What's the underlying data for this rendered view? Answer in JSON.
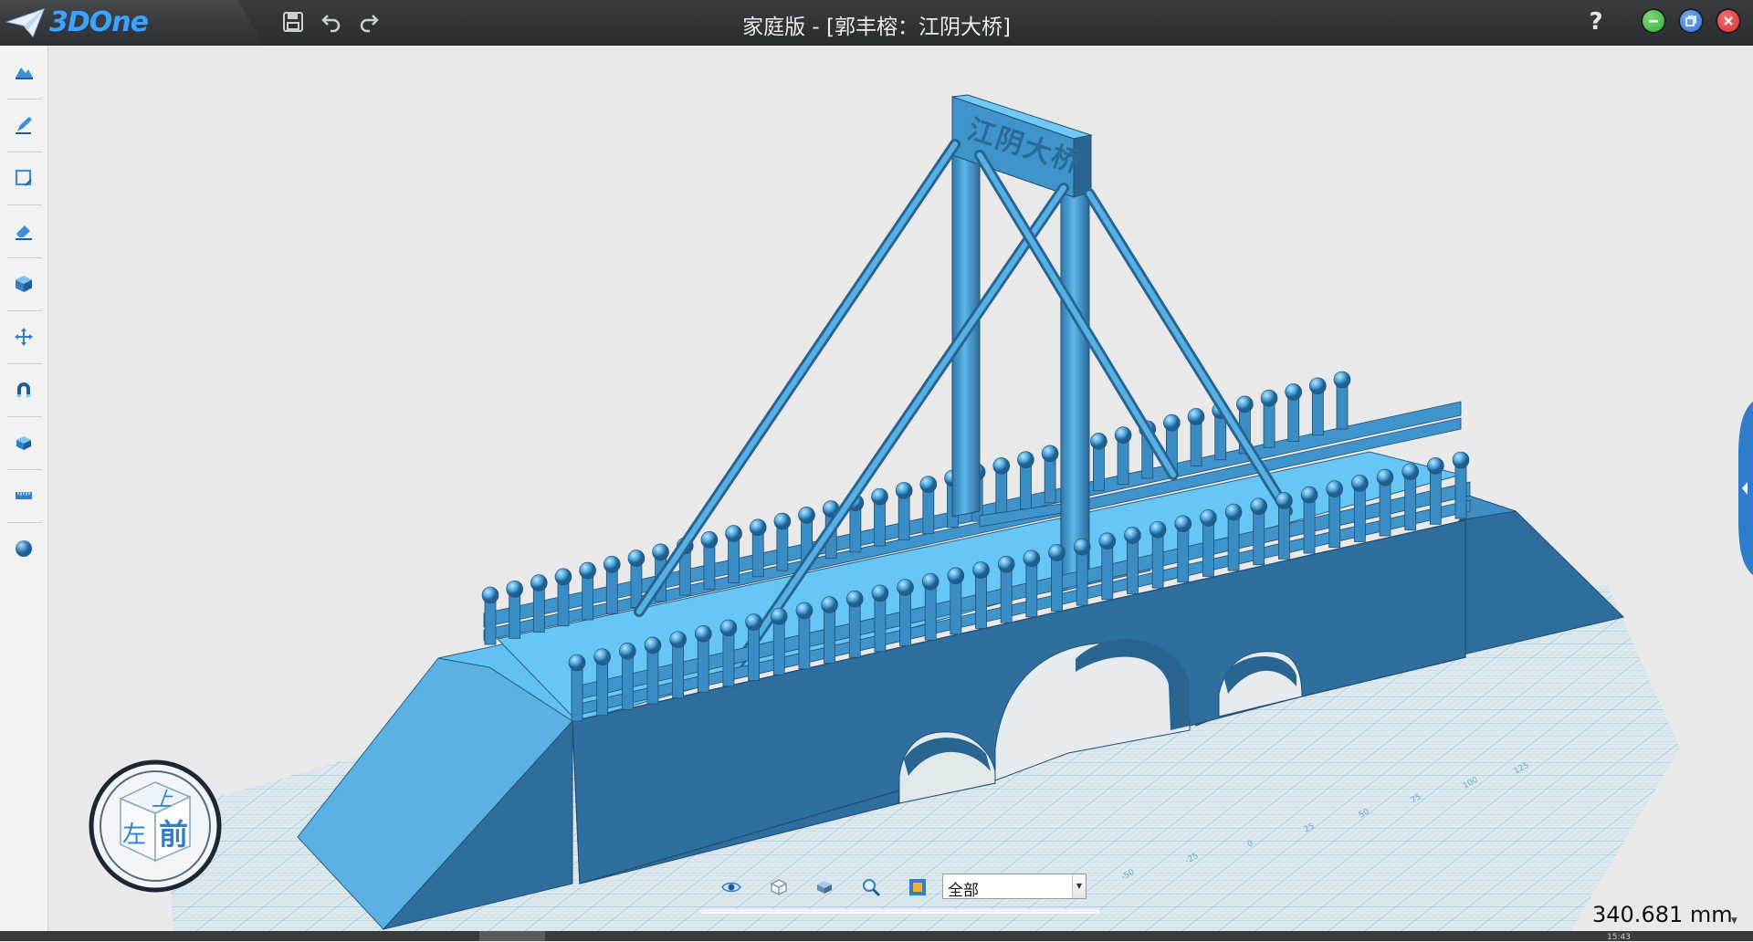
{
  "app": {
    "logo_text": "3DOne",
    "title": "家庭版 - [郭丰榕：江阴大桥]",
    "help_label": "?"
  },
  "quick_toolbar": {
    "items": [
      {
        "name": "save",
        "icon": "save-icon"
      },
      {
        "name": "undo",
        "icon": "undo-icon"
      },
      {
        "name": "redo",
        "icon": "redo-icon"
      }
    ]
  },
  "window_controls": [
    {
      "name": "minimize",
      "color": "#2fa82f"
    },
    {
      "name": "restore",
      "color": "#2d6fd8"
    },
    {
      "name": "close",
      "color": "#d62a2a"
    }
  ],
  "left_toolbar": {
    "items": [
      {
        "name": "primitives",
        "icon": "basic-solid-icon"
      },
      {
        "name": "sketch",
        "icon": "pencil-icon"
      },
      {
        "name": "sketch-edit",
        "icon": "square-edit-icon"
      },
      {
        "name": "special-features",
        "icon": "eraser-icon"
      },
      {
        "name": "boolean",
        "icon": "cube-icon"
      },
      {
        "name": "transform",
        "icon": "move-arrows-icon"
      },
      {
        "name": "attach",
        "icon": "magnet-icon"
      },
      {
        "name": "pattern",
        "icon": "box-pattern-icon"
      },
      {
        "name": "measure",
        "icon": "ruler-icon"
      },
      {
        "name": "render",
        "icon": "sphere-icon"
      }
    ]
  },
  "viewport": {
    "model_sign_text": "江阴大桥",
    "model_color": "#4ea9df",
    "grid_labels": [
      "-50",
      "-25",
      "0",
      "25",
      "50",
      "75",
      "100",
      "125"
    ],
    "view_cube": {
      "top": "上",
      "front": "前",
      "left": "左"
    }
  },
  "view_toolbar": {
    "items": [
      {
        "name": "show-hide",
        "icon": "eye-icon"
      },
      {
        "name": "display-mode",
        "icon": "wire-cube-icon"
      },
      {
        "name": "render-mode",
        "icon": "shaded-box-icon"
      },
      {
        "name": "zoom",
        "icon": "magnifier-icon"
      },
      {
        "name": "view-fit",
        "icon": "frame-icon"
      }
    ],
    "filter_value": "全部"
  },
  "status": {
    "measurement": "340.681 mm",
    "clock": "15:43"
  }
}
